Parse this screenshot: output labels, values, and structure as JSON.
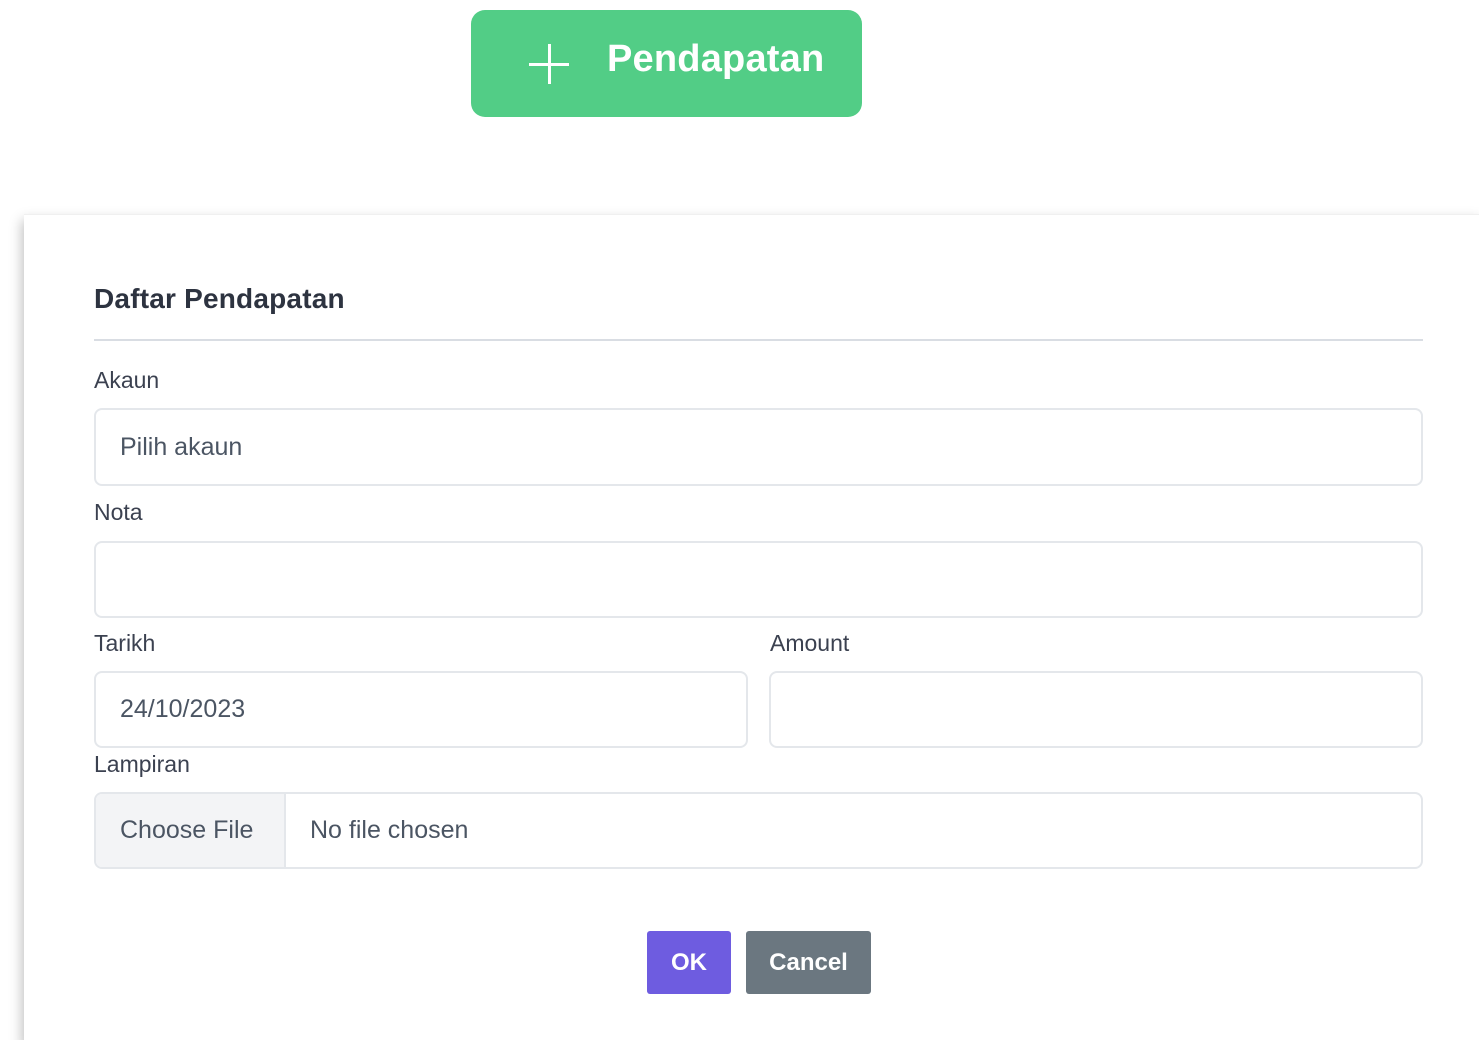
{
  "header": {
    "add_button_label": "Pendapatan",
    "add_button_icon": "plus-icon",
    "add_button_color": "#52cd86"
  },
  "modal": {
    "title": "Daftar Pendapatan",
    "fields": {
      "akaun": {
        "label": "Akaun",
        "placeholder": "Pilih akaun",
        "value": ""
      },
      "nota": {
        "label": "Nota",
        "value": ""
      },
      "tarikh": {
        "label": "Tarikh",
        "value": "24/10/2023"
      },
      "amount": {
        "label": "Amount",
        "value": ""
      },
      "lampiran": {
        "label": "Lampiran",
        "button_label": "Choose File",
        "status": "No file chosen"
      }
    },
    "buttons": {
      "ok_label": "OK",
      "ok_color": "#6e5ce0",
      "cancel_label": "Cancel",
      "cancel_color": "#6b7780"
    }
  }
}
